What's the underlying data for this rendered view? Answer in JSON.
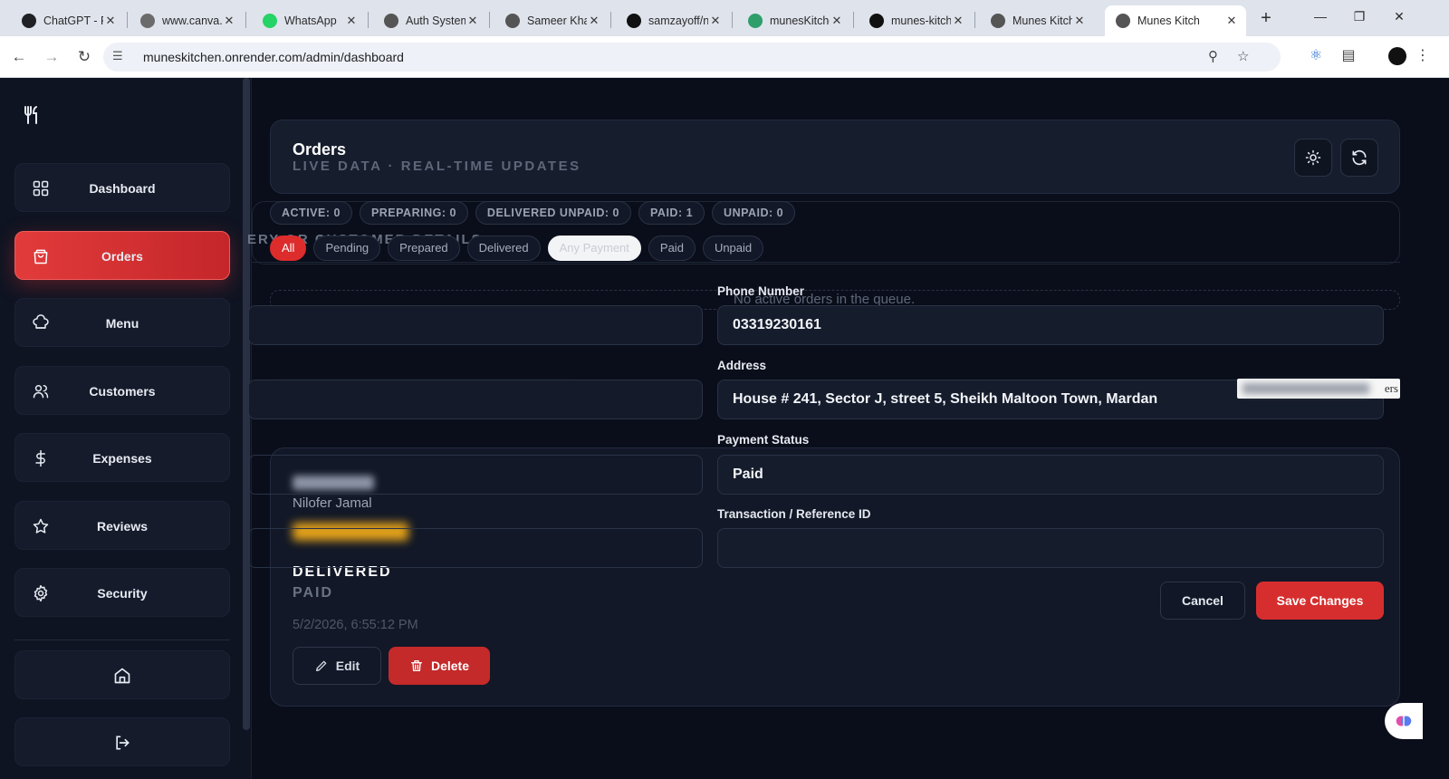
{
  "browser": {
    "tabs": [
      {
        "label": "ChatGPT - P",
        "icon": "chatgpt-icon",
        "color": "#202124"
      },
      {
        "label": "www.canva.c",
        "icon": "canva-icon",
        "color": "#6b6b6b"
      },
      {
        "label": "WhatsApp",
        "icon": "whatsapp-icon",
        "color": "#25d366"
      },
      {
        "label": "Auth System",
        "icon": "openai-icon",
        "color": "#555555"
      },
      {
        "label": "Sameer Kha",
        "icon": "globe-icon",
        "color": "#555555"
      },
      {
        "label": "samzayoff/n",
        "icon": "github-icon",
        "color": "#111111"
      },
      {
        "label": "munesKitche",
        "icon": "render-icon",
        "color": "#2f9e6a"
      },
      {
        "label": "munes-kitch",
        "icon": "vercel-icon",
        "color": "#111111"
      },
      {
        "label": "Munes Kitch",
        "icon": "globe-icon",
        "color": "#555555"
      },
      {
        "label": "Munes Kitch",
        "icon": "globe-icon",
        "color": "#555555"
      }
    ],
    "active_tab_index": 9,
    "url": "muneskitchen.onrender.com/admin/dashboard"
  },
  "sidebar": {
    "items": [
      {
        "label": "Dashboard",
        "icon": "grid-icon",
        "active": false
      },
      {
        "label": "Orders",
        "icon": "shopping-bag-icon",
        "active": true
      },
      {
        "label": "Menu",
        "icon": "chef-hat-icon",
        "active": false
      },
      {
        "label": "Customers",
        "icon": "users-icon",
        "active": false
      },
      {
        "label": "Expenses",
        "icon": "dollar-icon",
        "active": false
      },
      {
        "label": "Reviews",
        "icon": "star-icon",
        "active": false
      },
      {
        "label": "Security",
        "icon": "gear-icon",
        "active": false
      }
    ],
    "bottom": [
      {
        "icon": "home-icon"
      },
      {
        "icon": "logout-icon"
      }
    ]
  },
  "header": {
    "title": "Orders",
    "subtitle": "LIVE DATA · REAL-TIME UPDATES"
  },
  "stats": [
    "ACTIVE: 0",
    "PREPARING: 0",
    "DELIVERED UNPAID: 0",
    "PAID: 1",
    "UNPAID: 0"
  ],
  "ghost_heading": "ERY OR CUSTOMER DETAILS",
  "filters": [
    {
      "label": "All",
      "style": "red"
    },
    {
      "label": "Pending",
      "style": "normal"
    },
    {
      "label": "Prepared",
      "style": "normal"
    },
    {
      "label": "Delivered",
      "style": "normal"
    },
    {
      "label": "Any Payment",
      "style": "white"
    },
    {
      "label": "Paid",
      "style": "normal"
    },
    {
      "label": "Unpaid",
      "style": "normal"
    }
  ],
  "empty_queue": "No active orders in the queue.",
  "order": {
    "customer": "Nilofer Jamal",
    "status": "DELIVERED",
    "payment": "PAID",
    "date": "5/2/2026, 6:55:12 PM",
    "edit_label": "Edit",
    "delete_label": "Delete"
  },
  "form": {
    "phone_label": "Phone Number",
    "phone_value": "03319230161",
    "address_label": "Address",
    "address_value": "House # 241, Sector J, street 5, Sheikh Maltoon Town, Mardan",
    "payment_status_label": "Payment Status",
    "payment_status_value": "Paid",
    "txn_label": "Transaction / Reference ID",
    "txn_value": "",
    "cancel_label": "Cancel",
    "save_label": "Save Changes"
  },
  "floating_tag_text": "ers"
}
